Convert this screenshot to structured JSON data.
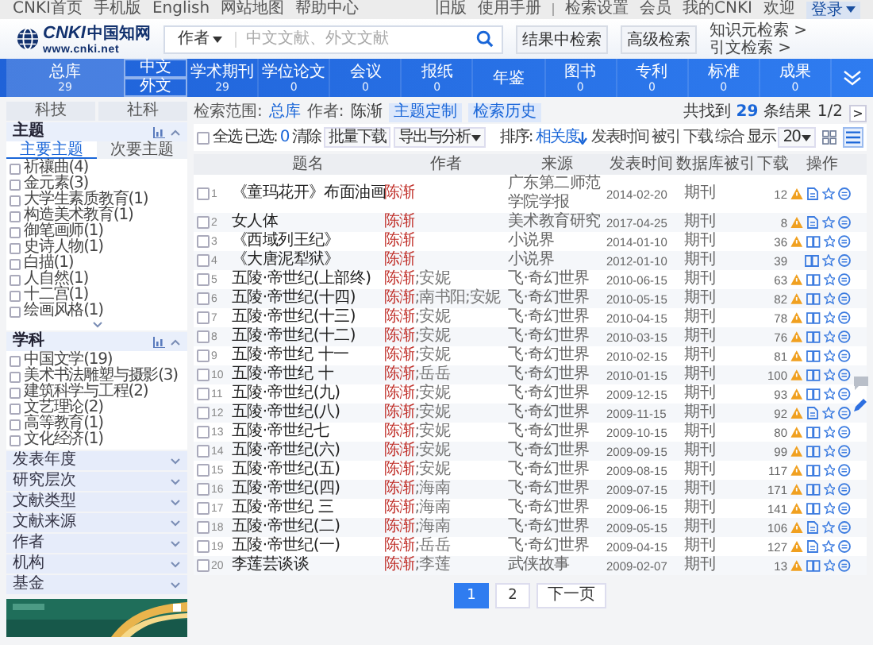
{
  "top_bar": {
    "left_links": [
      "CNKI首页",
      "手机版",
      "English",
      "网站地图",
      "帮助中心"
    ],
    "right_link_groups": [
      [
        "旧版",
        "使用手册"
      ],
      [
        "检索设置",
        "会员",
        "我的CNKI",
        "欢迎"
      ]
    ],
    "login": "登录"
  },
  "header": {
    "logo": {
      "mark": "CNKI",
      "name": "中国知网",
      "url": "www.cnki.net"
    },
    "search": {
      "scope": "作者",
      "placeholder": "中文文献、外文文献"
    },
    "buttons": [
      "结果中检索",
      "高级检索"
    ],
    "links": [
      "知识元检索 >",
      "引文检索 >"
    ]
  },
  "nav": {
    "total": {
      "label": "总库",
      "count": "29",
      "selected": true
    },
    "languages": [
      {
        "label": "中文",
        "selected": false
      },
      {
        "label": "外文",
        "selected": false
      }
    ],
    "databases": [
      {
        "label": "学术期刊",
        "count": "29"
      },
      {
        "label": "学位论文",
        "count": "0"
      },
      {
        "label": "会议",
        "count": "0"
      },
      {
        "label": "报纸",
        "count": "0"
      },
      {
        "label": "年鉴"
      },
      {
        "label": "图书",
        "count": "0"
      },
      {
        "label": "专利",
        "count": "0"
      },
      {
        "label": "标准",
        "count": "0"
      },
      {
        "label": "成果",
        "count": "0"
      }
    ]
  },
  "sidebar": {
    "tabs": [
      {
        "label": "科技",
        "selected": false
      },
      {
        "label": "社科",
        "selected": false
      }
    ],
    "facets": [
      {
        "title": "主题",
        "expanded": true,
        "has_more": true,
        "tabs": [
          {
            "label": "主要主题",
            "selected": true
          },
          {
            "label": "次要主题",
            "selected": false
          }
        ],
        "items": [
          {
            "label": "祈禳曲(4)",
            "checked": false
          },
          {
            "label": "金元素(3)",
            "checked": false
          },
          {
            "label": "大学生素质教育(1)",
            "checked": false
          },
          {
            "label": "构造美术教育(1)",
            "checked": false
          },
          {
            "label": "御笔画师(1)",
            "checked": false
          },
          {
            "label": "史诗人物(1)",
            "checked": false
          },
          {
            "label": "白描(1)",
            "checked": false
          },
          {
            "label": "人自然(1)",
            "checked": false
          },
          {
            "label": "十二宫(1)",
            "checked": false
          },
          {
            "label": "绘画风格(1)",
            "checked": false
          }
        ]
      },
      {
        "title": "学科",
        "expanded": true,
        "has_more": false,
        "items": [
          {
            "label": "中国文学(19)",
            "checked": false
          },
          {
            "label": "美术书法雕塑与摄影(3)",
            "checked": false
          },
          {
            "label": "建筑科学与工程(2)",
            "checked": false
          },
          {
            "label": "文艺理论(2)",
            "checked": false
          },
          {
            "label": "高等教育(1)",
            "checked": false
          },
          {
            "label": "文化经济(1)",
            "checked": false
          }
        ]
      },
      {
        "title": "发表年度",
        "expanded": false
      },
      {
        "title": "研究层次",
        "expanded": false
      },
      {
        "title": "文献类型",
        "expanded": false
      },
      {
        "title": "文献来源",
        "expanded": false
      },
      {
        "title": "作者",
        "expanded": false
      },
      {
        "title": "机构",
        "expanded": false
      },
      {
        "title": "基金",
        "expanded": false
      }
    ]
  },
  "results": {
    "scope_label": "检索范围:",
    "scope": "总库",
    "author_label": "作者:",
    "author": "陈渐",
    "tags": [
      "主题定制",
      "检索历史"
    ],
    "summary": "共找到 **29** 条结果",
    "page_counter": "1/2",
    "next_page_arrow": ">",
    "toolbar": {
      "select_all": {
        "label": "全选",
        "checked": false
      },
      "selected_label": "已选:",
      "selected_count": "0",
      "clear": "清除",
      "batch_download": "批量下载",
      "export": "导出与分析",
      "sort_label": "排序:",
      "sort_options": [
        {
          "label": "相关度",
          "selected": true
        },
        {
          "label": "发表时间",
          "selected": false
        },
        {
          "label": "被引",
          "selected": false
        },
        {
          "label": "下载",
          "selected": false
        },
        {
          "label": "综合",
          "selected": false
        }
      ],
      "page_size_label": "显示",
      "page_size": "20",
      "views": [
        {
          "kind": "grid",
          "selected": false
        },
        {
          "kind": "list",
          "selected": true
        }
      ]
    },
    "columns": [
      "题名",
      "作者",
      "来源",
      "发表时间",
      "数据库",
      "被引",
      "下载",
      "操作"
    ],
    "author_separator": ";",
    "rows": [
      {
        "checked": false,
        "index": "1",
        "title": "《童玛花开》布面油画",
        "authors": [
          {
            "name": "陈渐",
            "matched": true
          }
        ],
        "source": "广东第二师范学院学报",
        "date": "2014-02-20",
        "database": "期刊",
        "downloads": "12",
        "alert": true,
        "preview": {
          "kind": "page"
        }
      },
      {
        "checked": false,
        "index": "2",
        "title": "女人体",
        "authors": [
          {
            "name": "陈渐",
            "matched": true
          }
        ],
        "source": "美术教育研究",
        "date": "2017-04-25",
        "database": "期刊",
        "downloads": "8",
        "alert": true,
        "preview": {
          "kind": "page"
        }
      },
      {
        "checked": false,
        "index": "3",
        "title": "《西域列王纪》",
        "authors": [
          {
            "name": "陈渐",
            "matched": true
          }
        ],
        "source": "小说界",
        "date": "2014-01-10",
        "database": "期刊",
        "downloads": "36",
        "alert": true,
        "preview": {
          "kind": "book"
        }
      },
      {
        "checked": false,
        "index": "4",
        "title": "《大唐泥犁狱》",
        "authors": [
          {
            "name": "陈渐",
            "matched": true
          }
        ],
        "source": "小说界",
        "date": "2012-01-10",
        "database": "期刊",
        "downloads": "39",
        "alert": false,
        "preview": {
          "kind": "book"
        }
      },
      {
        "checked": false,
        "index": "5",
        "title": "五陵·帝世纪(上部终)",
        "authors": [
          {
            "name": "陈渐",
            "matched": true
          },
          {
            "name": "安妮",
            "matched": false
          }
        ],
        "source": "飞·奇幻世界",
        "date": "2010-06-15",
        "database": "期刊",
        "downloads": "63",
        "alert": true,
        "preview": {
          "kind": "book"
        }
      },
      {
        "checked": false,
        "index": "6",
        "title": "五陵·帝世纪(十四)",
        "authors": [
          {
            "name": "陈渐",
            "matched": true
          },
          {
            "name": "南书阳",
            "matched": false
          },
          {
            "name": "安妮",
            "matched": false
          }
        ],
        "source": "飞·奇幻世界",
        "date": "2010-05-15",
        "database": "期刊",
        "downloads": "82",
        "alert": true,
        "preview": {
          "kind": "book"
        }
      },
      {
        "checked": false,
        "index": "7",
        "title": "五陵·帝世纪(十三)",
        "authors": [
          {
            "name": "陈渐",
            "matched": true
          },
          {
            "name": "安妮",
            "matched": false
          }
        ],
        "source": "飞·奇幻世界",
        "date": "2010-04-15",
        "database": "期刊",
        "downloads": "78",
        "alert": true,
        "preview": {
          "kind": "book"
        }
      },
      {
        "checked": false,
        "index": "8",
        "title": "五陵·帝世纪(十二)",
        "authors": [
          {
            "name": "陈渐",
            "matched": true
          },
          {
            "name": "安妮",
            "matched": false
          }
        ],
        "source": "飞·奇幻世界",
        "date": "2010-03-15",
        "database": "期刊",
        "downloads": "76",
        "alert": true,
        "preview": {
          "kind": "book"
        }
      },
      {
        "checked": false,
        "index": "9",
        "title": "五陵·帝世纪 十一",
        "authors": [
          {
            "name": "陈渐",
            "matched": true
          },
          {
            "name": "安妮",
            "matched": false
          }
        ],
        "source": "飞·奇幻世界",
        "date": "2010-02-15",
        "database": "期刊",
        "downloads": "81",
        "alert": true,
        "preview": {
          "kind": "book"
        }
      },
      {
        "checked": false,
        "index": "10",
        "title": "五陵·帝世纪 十",
        "authors": [
          {
            "name": "陈渐",
            "matched": true
          },
          {
            "name": "岳岳",
            "matched": false
          }
        ],
        "source": "飞·奇幻世界",
        "date": "2010-01-15",
        "database": "期刊",
        "downloads": "100",
        "alert": true,
        "preview": {
          "kind": "book"
        }
      },
      {
        "checked": false,
        "index": "11",
        "title": "五陵·帝世纪(九)",
        "authors": [
          {
            "name": "陈渐",
            "matched": true
          },
          {
            "name": "安妮",
            "matched": false
          }
        ],
        "source": "飞·奇幻世界",
        "date": "2009-12-15",
        "database": "期刊",
        "downloads": "93",
        "alert": true,
        "preview": {
          "kind": "book"
        }
      },
      {
        "checked": false,
        "index": "12",
        "title": "五陵·帝世纪(八)",
        "authors": [
          {
            "name": "陈渐",
            "matched": true
          },
          {
            "name": "安妮",
            "matched": false
          }
        ],
        "source": "飞·奇幻世界",
        "date": "2009-11-15",
        "database": "期刊",
        "downloads": "92",
        "alert": true,
        "preview": {
          "kind": "page"
        }
      },
      {
        "checked": false,
        "index": "13",
        "title": "五陵·帝世纪七",
        "authors": [
          {
            "name": "陈渐",
            "matched": true
          },
          {
            "name": "安妮",
            "matched": false
          }
        ],
        "source": "飞·奇幻世界",
        "date": "2009-10-15",
        "database": "期刊",
        "downloads": "80",
        "alert": true,
        "preview": {
          "kind": "book"
        }
      },
      {
        "checked": false,
        "index": "14",
        "title": "五陵·帝世纪(六)",
        "authors": [
          {
            "name": "陈渐",
            "matched": true
          },
          {
            "name": "安妮",
            "matched": false
          }
        ],
        "source": "飞·奇幻世界",
        "date": "2009-09-15",
        "database": "期刊",
        "downloads": "99",
        "alert": true,
        "preview": {
          "kind": "book"
        }
      },
      {
        "checked": false,
        "index": "15",
        "title": "五陵·帝世纪(五)",
        "authors": [
          {
            "name": "陈渐",
            "matched": true
          },
          {
            "name": "安妮",
            "matched": false
          }
        ],
        "source": "飞·奇幻世界",
        "date": "2009-08-15",
        "database": "期刊",
        "downloads": "117",
        "alert": true,
        "preview": {
          "kind": "book"
        }
      },
      {
        "checked": false,
        "index": "16",
        "title": "五陵·帝世纪(四)",
        "authors": [
          {
            "name": "陈渐",
            "matched": true
          },
          {
            "name": "海南",
            "matched": false
          }
        ],
        "source": "飞·奇幻世界",
        "date": "2009-07-15",
        "database": "期刊",
        "downloads": "171",
        "alert": true,
        "preview": {
          "kind": "book"
        }
      },
      {
        "checked": false,
        "index": "17",
        "title": "五陵·帝世纪 三",
        "authors": [
          {
            "name": "陈渐",
            "matched": true
          },
          {
            "name": "海南",
            "matched": false
          }
        ],
        "source": "飞·奇幻世界",
        "date": "2009-06-15",
        "database": "期刊",
        "downloads": "141",
        "alert": true,
        "preview": {
          "kind": "book"
        }
      },
      {
        "checked": false,
        "index": "18",
        "title": "五陵·帝世纪(二)",
        "authors": [
          {
            "name": "陈渐",
            "matched": true
          },
          {
            "name": "海南",
            "matched": false
          }
        ],
        "source": "飞·奇幻世界",
        "date": "2009-05-15",
        "database": "期刊",
        "downloads": "106",
        "alert": true,
        "preview": {
          "kind": "page"
        }
      },
      {
        "checked": false,
        "index": "19",
        "title": "五陵·帝世纪(一)",
        "authors": [
          {
            "name": "陈渐",
            "matched": true
          },
          {
            "name": "岳岳",
            "matched": false
          }
        ],
        "source": "飞·奇幻世界",
        "date": "2009-04-15",
        "database": "期刊",
        "downloads": "127",
        "alert": true,
        "preview": {
          "kind": "page"
        }
      },
      {
        "checked": false,
        "index": "20",
        "title": "李莲芸谈谈",
        "authors": [
          {
            "name": "陈渐",
            "matched": true
          },
          {
            "name": "李莲",
            "matched": false
          }
        ],
        "source": "武侠故事",
        "date": "2009-02-07",
        "database": "期刊",
        "downloads": "13",
        "alert": true,
        "preview": {
          "kind": "book"
        }
      }
    ],
    "pagination": {
      "pages": [
        {
          "label": "1",
          "selected": true
        },
        {
          "label": "2",
          "selected": false
        }
      ],
      "next": "下一页"
    }
  }
}
